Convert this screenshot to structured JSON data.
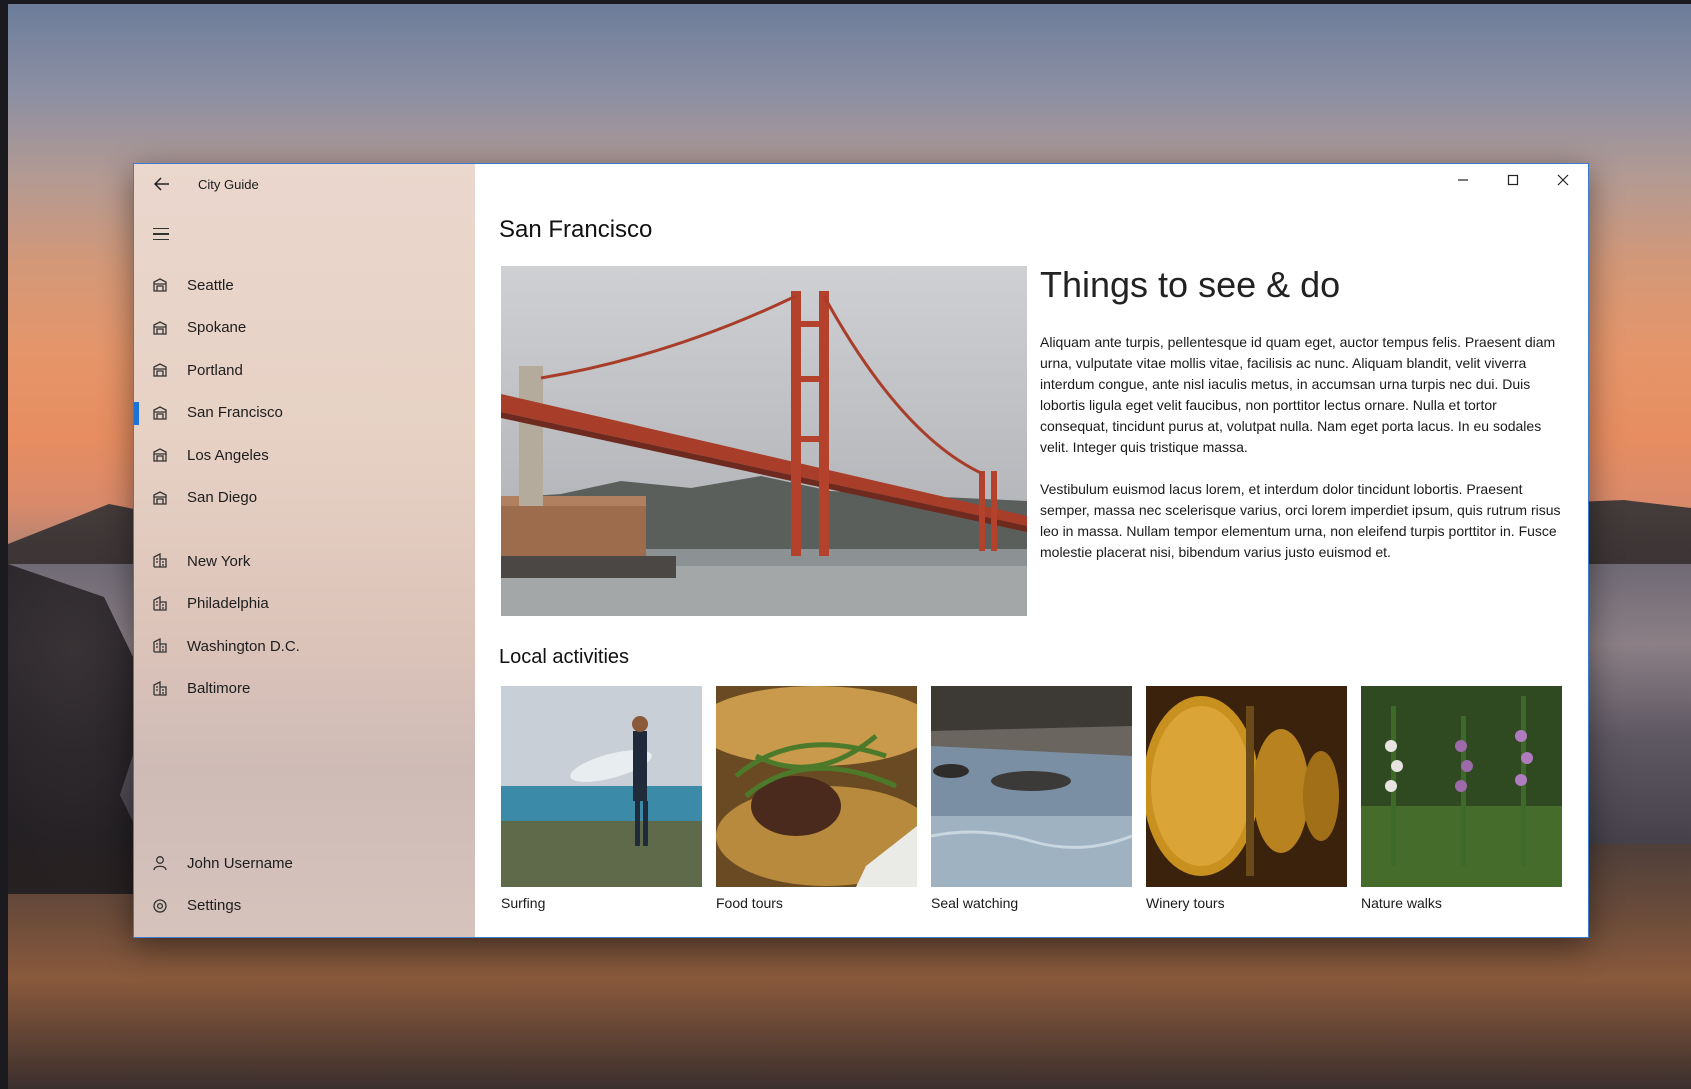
{
  "window": {
    "title": "City Guide",
    "back_icon": "back-arrow-icon",
    "caption": {
      "minimize": "−",
      "maximize": "☐",
      "close": "✕"
    }
  },
  "nav": {
    "menu_icon": "hamburger-icon",
    "west_icon": "stadium-icon",
    "east_icon": "building-icon",
    "west_cities": [
      {
        "label": "Seattle",
        "selected": false
      },
      {
        "label": "Spokane",
        "selected": false
      },
      {
        "label": "Portland",
        "selected": false
      },
      {
        "label": "San Francisco",
        "selected": true
      },
      {
        "label": "Los Angeles",
        "selected": false
      },
      {
        "label": "San Diego",
        "selected": false
      }
    ],
    "east_cities": [
      {
        "label": "New York"
      },
      {
        "label": "Philadelphia"
      },
      {
        "label": "Washington D.C."
      },
      {
        "label": "Baltimore"
      }
    ],
    "footer": {
      "user": "John Username",
      "settings": "Settings"
    },
    "accent_color": "#1a73d8"
  },
  "main": {
    "page_title": "San Francisco",
    "heading": "Things to see & do",
    "paragraphs": [
      "Aliquam ante turpis, pellentesque id quam eget, auctor tempus felis. Praesent diam urna, vulputate vitae mollis vitae, facilisis ac nunc. Aliquam blandit, velit viverra interdum congue, ante nisl iaculis metus, in accumsan urna turpis nec dui. Duis lobortis ligula eget velit faucibus, non porttitor lectus ornare. Nulla et tortor consequat, tincidunt purus at, volutpat nulla. Nam eget porta lacus. In eu sodales velit. Integer quis tristique massa.",
      "Vestibulum euismod lacus lorem, et interdum dolor tincidunt lobortis. Praesent semper, massa nec scelerisque varius, orci lorem imperdiet ipsum, quis rutrum risus leo in massa. Nullam tempor elementum urna, non eleifend turpis porttitor in. Fusce molestie placerat nisi, bibendum varius justo euismod et."
    ],
    "activities_title": "Local activities",
    "activities": [
      {
        "label": "Surfing"
      },
      {
        "label": "Food tours"
      },
      {
        "label": "Seal watching"
      },
      {
        "label": "Winery tours"
      },
      {
        "label": "Nature walks"
      }
    ]
  }
}
